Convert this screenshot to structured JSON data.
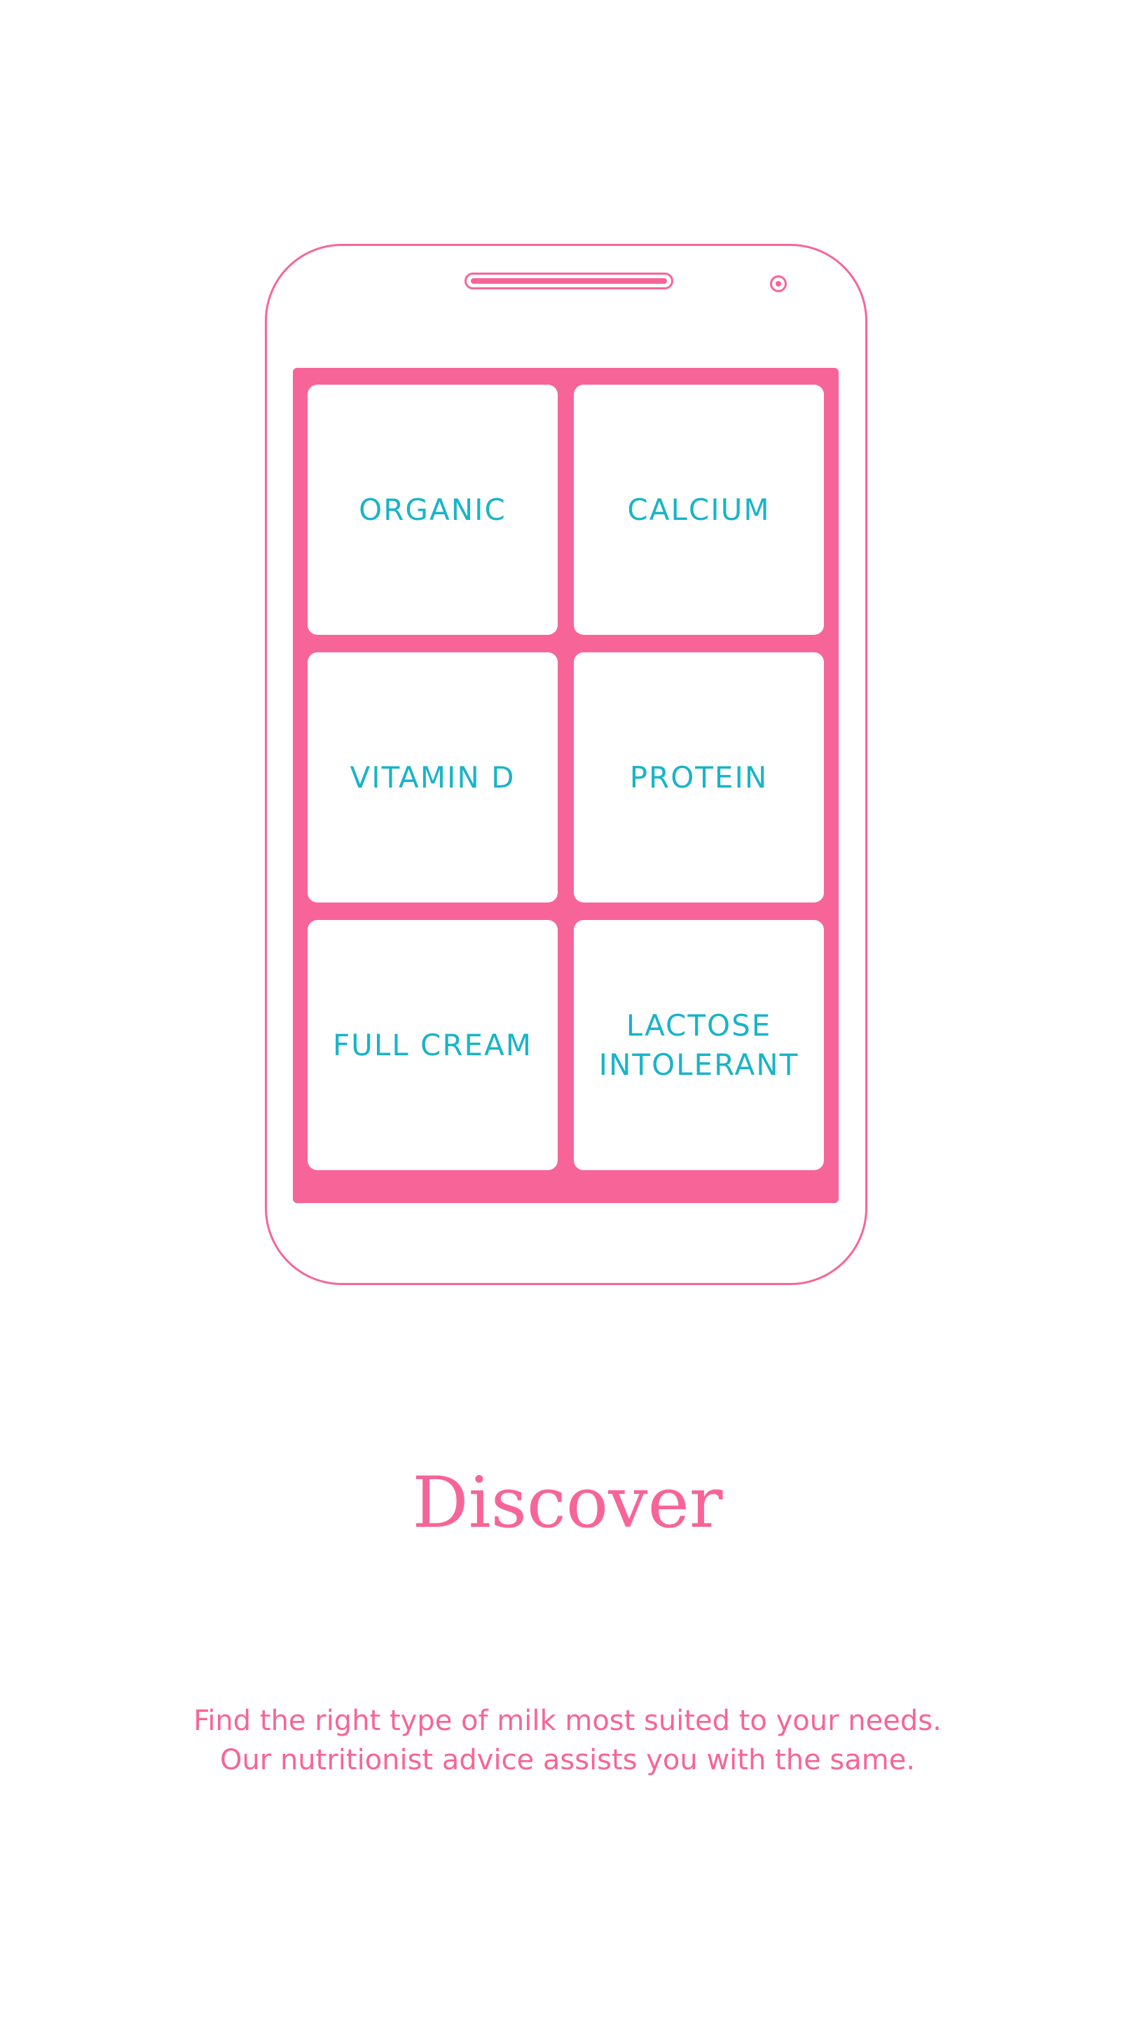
{
  "colors": {
    "accent_pink": "#f76598",
    "tile_text_teal": "#19b4c8",
    "background": "#ffffff"
  },
  "phone": {
    "speaker_icon": "speaker-grille",
    "camera_icon": "front-camera"
  },
  "options": [
    {
      "label": "ORGANIC"
    },
    {
      "label": "CALCIUM"
    },
    {
      "label": "VITAMIN D"
    },
    {
      "label": "PROTEIN"
    },
    {
      "label": "FULL CREAM"
    },
    {
      "label": "LACTOSE\nINTOLERANT"
    }
  ],
  "headline": "Discover",
  "description": {
    "line1": "Find the right type of milk most suited to your needs.",
    "line2": "Our nutritionist advice assists you with the same."
  }
}
